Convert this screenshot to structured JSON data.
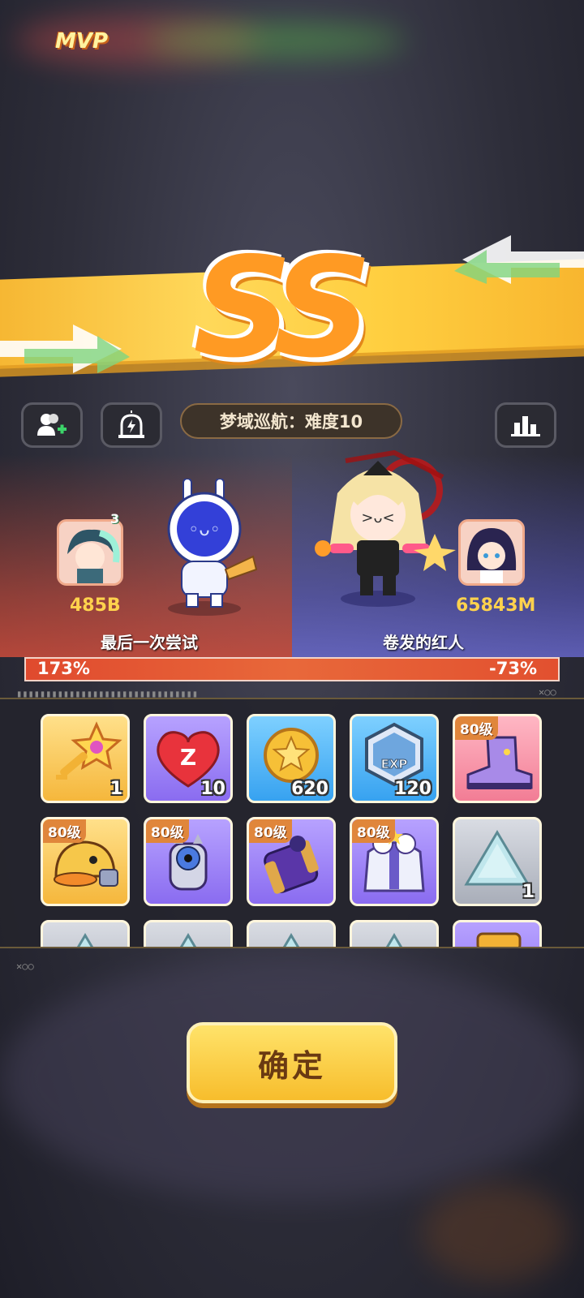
{
  "result": {
    "grade": "SS"
  },
  "header": {
    "mode_title": "梦域巡航：难度10",
    "buttons": [
      "add-friend-icon",
      "report-alarm-icon",
      "stats-chart-icon"
    ]
  },
  "battle": {
    "left": {
      "badge": "MVP",
      "player_level_badge": "3",
      "score": "485B",
      "name": "最后一次尝试"
    },
    "right": {
      "score": "65843M",
      "name": "卷发的红人"
    },
    "bar": {
      "left_value": "173%",
      "right_value": "-73%"
    }
  },
  "rewards": [
    {
      "icon": "star-key-icon",
      "tile": "gold",
      "qty": "1",
      "level": ""
    },
    {
      "icon": "heart-z-icon",
      "tile": "purple",
      "qty": "10",
      "level": ""
    },
    {
      "icon": "gold-coin-icon",
      "tile": "blue",
      "qty": "620",
      "level": ""
    },
    {
      "icon": "exp-badge-icon",
      "tile": "blue",
      "qty": "120",
      "level": ""
    },
    {
      "icon": "boot-icon",
      "tile": "pink",
      "qty": "",
      "level": "80级"
    },
    {
      "icon": "duck-helmet-icon",
      "tile": "gold",
      "qty": "",
      "level": "80级"
    },
    {
      "icon": "eye-gauntlet-icon",
      "tile": "purple",
      "qty": "",
      "level": "80级"
    },
    {
      "icon": "bracer-icon",
      "tile": "purple",
      "qty": "",
      "level": "80级"
    },
    {
      "icon": "puffy-jacket-icon",
      "tile": "purple",
      "qty": "",
      "level": "80级"
    },
    {
      "icon": "crystal-shard-icon",
      "tile": "gray",
      "qty": "1",
      "level": ""
    },
    {
      "icon": "crystal-shard-icon",
      "tile": "gray",
      "qty": "",
      "level": ""
    },
    {
      "icon": "crystal-shard-icon",
      "tile": "gray",
      "qty": "",
      "level": ""
    },
    {
      "icon": "crystal-shard-icon",
      "tile": "gray",
      "qty": "",
      "level": ""
    },
    {
      "icon": "crystal-shard-icon",
      "tile": "gray",
      "qty": "",
      "level": ""
    },
    {
      "icon": "gold-item-icon",
      "tile": "purple",
      "qty": "",
      "level": ""
    }
  ],
  "confirm_label": "确定",
  "colors": {
    "accent": "#f7bd2c",
    "bar": "#e04a2e",
    "score": "#ffd24d"
  }
}
